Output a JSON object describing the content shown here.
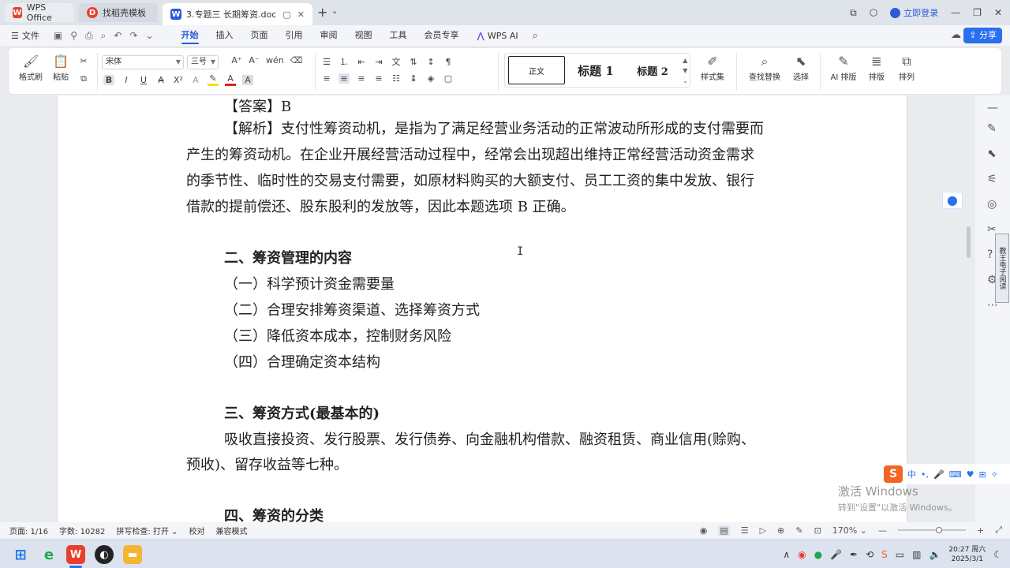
{
  "titlebar": {
    "tabs": [
      {
        "label": "WPS Office",
        "icon": "wps-logo-icon"
      },
      {
        "label": "找稻壳模板",
        "icon": "docer-icon"
      },
      {
        "label": "3.专题三 长期筹资.doc",
        "icon": "word-doc-icon"
      }
    ],
    "login_label": "立即登录"
  },
  "menubar": {
    "file_label": "文件",
    "items": [
      "开始",
      "插入",
      "页面",
      "引用",
      "审阅",
      "视图",
      "工具",
      "会员专享"
    ],
    "active": "开始",
    "ai_label": "WPS AI",
    "share_label": "分享"
  },
  "ribbon": {
    "format_painter": "格式刷",
    "paste": "粘贴",
    "font_name": "宋体",
    "font_size": "三号",
    "styles": {
      "normal": "正文",
      "h1": "标题 1",
      "h2": "标题 2"
    },
    "style_set": "样式集",
    "find_replace": "查找替换",
    "select": "选择",
    "ai_layout": "AI 排版",
    "layout": "排版",
    "arrange": "排列"
  },
  "document": {
    "lines": [
      {
        "text": "【答案】B",
        "indent": 1,
        "bold": false
      },
      {
        "text": "【解析】支付性筹资动机，是指为了满足经营业务活动的正常波动所形成的支付需要而",
        "indent": 1,
        "bold": false
      },
      {
        "text": "产生的筹资动机。在企业开展经营活动过程中，经常会出现超出维持正常经营活动资金需求",
        "indent": 0,
        "bold": false
      },
      {
        "text": "的季节性、临时性的交易支付需要，如原材料购买的大额支付、员工工资的集中发放、银行",
        "indent": 0,
        "bold": false
      },
      {
        "text": "借款的提前偿还、股东股利的发放等，因此本题选项 B 正确。",
        "indent": 0,
        "bold": false
      },
      {
        "text": "二、筹资管理的内容",
        "indent": 1,
        "bold": true
      },
      {
        "text": "（一）科学预计资金需要量",
        "indent": 1,
        "bold": false
      },
      {
        "text": "（二）合理安排筹资渠道、选择筹资方式",
        "indent": 1,
        "bold": false
      },
      {
        "text": "（三）降低资本成本，控制财务风险",
        "indent": 1,
        "bold": false
      },
      {
        "text": "（四）合理确定资本结构",
        "indent": 1,
        "bold": false
      },
      {
        "text": "三、筹资方式(最基本的)",
        "indent": 1,
        "bold": true
      },
      {
        "text": "吸收直接投资、发行股票、发行债券、向金融机构借款、融资租赁、商业信用(赊购、",
        "indent": 1,
        "bold": false
      },
      {
        "text": "预收)、留存收益等七种。",
        "indent": 0,
        "bold": false
      },
      {
        "text": "四、筹资的分类",
        "indent": 1,
        "bold": true
      }
    ]
  },
  "ime": {
    "vertical_label": "教王电子阅读",
    "mode": "中"
  },
  "watermark": {
    "title": "激活 Windows",
    "subtitle": "转到\"设置\"以激活 Windows。"
  },
  "statusbar": {
    "page": "页面: 1/16",
    "words": "字数: 10282",
    "spellcheck": "拼写检查: 打开",
    "proofread": "校对",
    "compat": "兼容模式",
    "zoom": "170%",
    "zoom_level": 0.6
  },
  "taskbar": {
    "time": "20:27 周六",
    "date": "2025/3/1"
  }
}
